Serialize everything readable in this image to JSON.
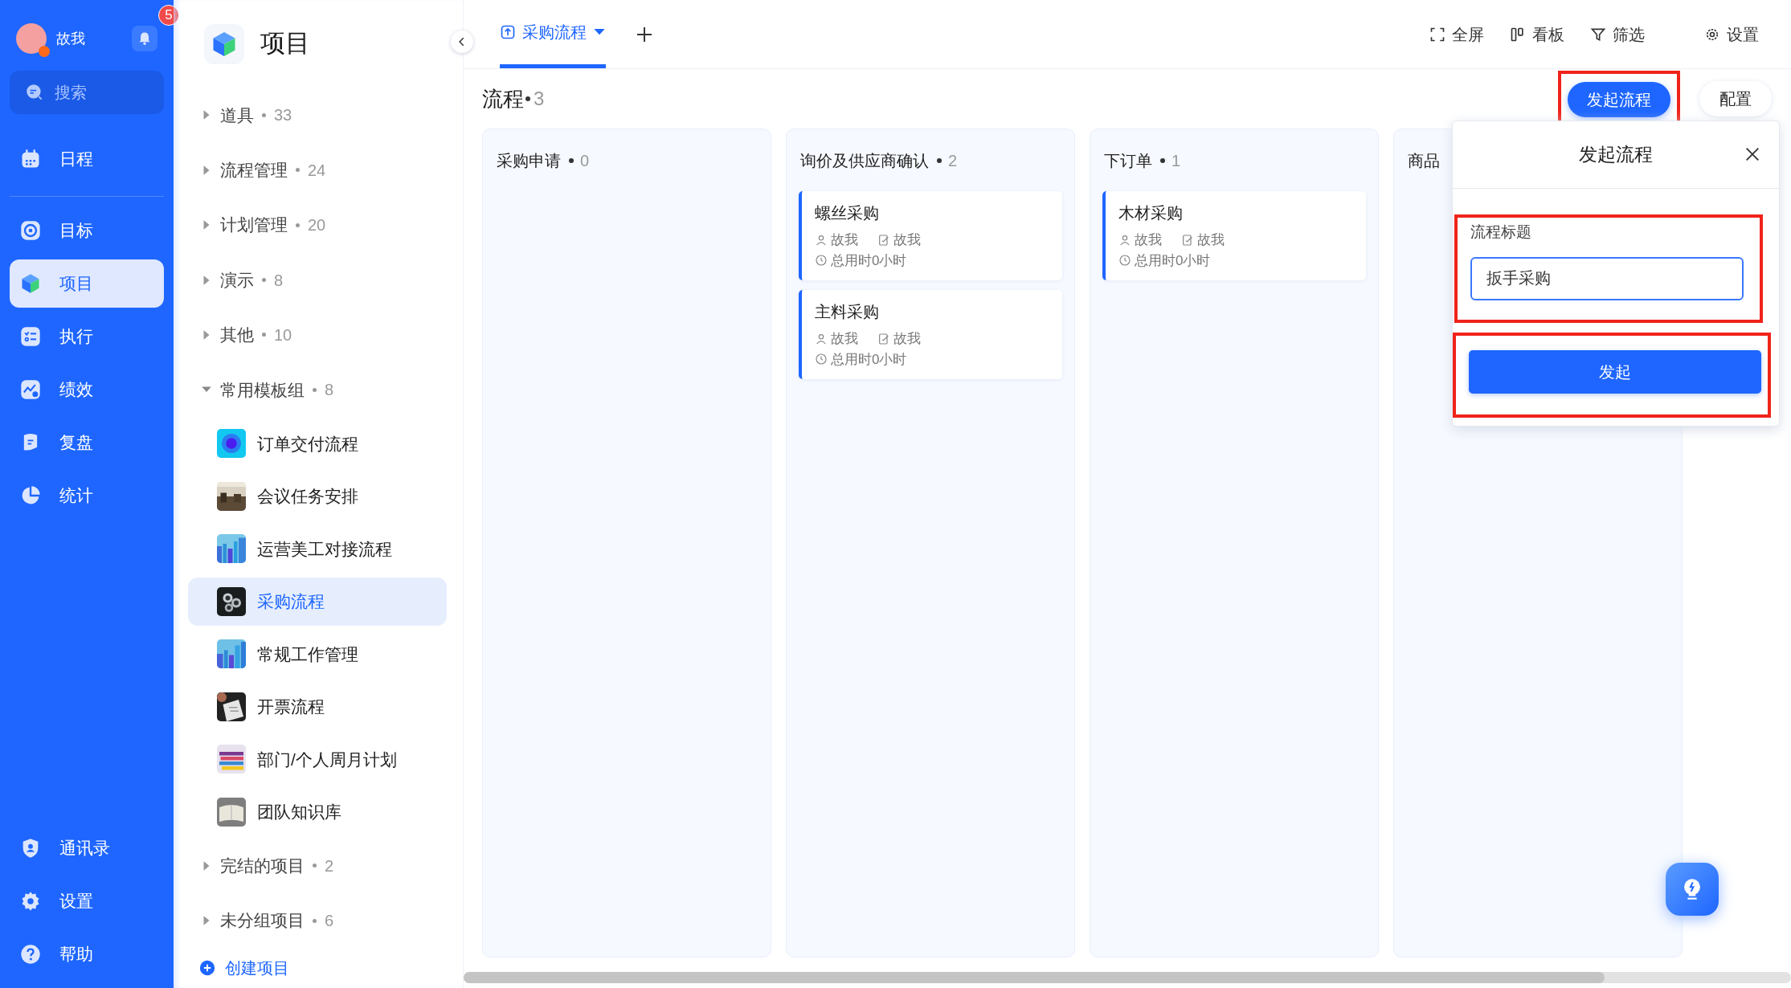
{
  "nav": {
    "user": {
      "name": "故我",
      "notifications": "5"
    },
    "search": {
      "placeholder": "搜索"
    },
    "items": [
      {
        "label": "日程",
        "selected": false
      },
      {
        "label": "目标",
        "selected": false
      },
      {
        "label": "项目",
        "selected": true
      },
      {
        "label": "执行",
        "selected": false
      },
      {
        "label": "绩效",
        "selected": false
      },
      {
        "label": "复盘",
        "selected": false
      },
      {
        "label": "统计",
        "selected": false
      }
    ],
    "bottom_items": [
      {
        "label": "通讯录",
        "selected": false
      },
      {
        "label": "设置",
        "selected": false
      },
      {
        "label": "帮助",
        "selected": false
      }
    ]
  },
  "projects": {
    "title": "项目",
    "groups": [
      {
        "label": "道具",
        "count": "33",
        "expanded": false
      },
      {
        "label": "流程管理",
        "count": "24",
        "expanded": false
      },
      {
        "label": "计划管理",
        "count": "20",
        "expanded": false
      },
      {
        "label": "演示",
        "count": "8",
        "expanded": false
      },
      {
        "label": "其他",
        "count": "10",
        "expanded": false
      },
      {
        "label": "常用模板组",
        "count": "8",
        "expanded": true,
        "children": [
          {
            "label": "订单交付流程",
            "selected": false
          },
          {
            "label": "会议任务安排",
            "selected": false
          },
          {
            "label": "运营美工对接流程",
            "selected": false
          },
          {
            "label": "采购流程",
            "selected": true
          },
          {
            "label": "常规工作管理",
            "selected": false
          },
          {
            "label": "开票流程",
            "selected": false
          },
          {
            "label": "部门/个人周月计划",
            "selected": false
          },
          {
            "label": "团队知识库",
            "selected": false
          }
        ]
      },
      {
        "label": "完结的项目",
        "count": "2",
        "expanded": false
      },
      {
        "label": "未分组项目",
        "count": "6",
        "expanded": false
      }
    ],
    "create": "创建项目"
  },
  "tabs": [
    {
      "label": "采购流程",
      "selected": true
    }
  ],
  "toolbar": [
    "全屏",
    "看板",
    "筛选",
    "设置"
  ],
  "board": {
    "title": "流程",
    "count": "3",
    "start_button": {
      "label": "发起流程",
      "highlighted": true
    },
    "config_button": "配置",
    "columns": [
      {
        "title": "采购申请",
        "count": "0"
      },
      {
        "title": "询价及供应商确认",
        "count": "2",
        "cards": [
          {
            "title": "螺丝采购",
            "owner": "故我",
            "assignee": "故我",
            "time": "总用时0小时"
          },
          {
            "title": "主料采购",
            "owner": "故我",
            "assignee": "故我",
            "time": "总用时0小时"
          }
        ]
      },
      {
        "title": "下订单",
        "count": "1",
        "cards": [
          {
            "title": "木材采购",
            "owner": "故我",
            "assignee": "故我",
            "time": "总用时0小时"
          }
        ]
      },
      {
        "title": "商品"
      }
    ]
  },
  "dialog": {
    "title": "发起流程",
    "field_label": "流程标题",
    "value": "扳手采购",
    "field_highlighted": true,
    "submit": "发起",
    "submit_highlighted": true
  }
}
